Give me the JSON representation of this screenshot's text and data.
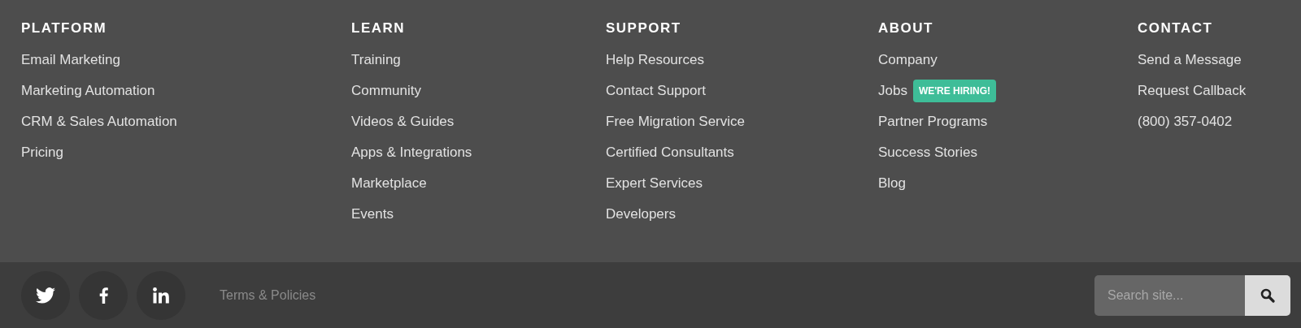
{
  "columns": [
    {
      "heading": "PLATFORM",
      "links": [
        {
          "label": "Email Marketing"
        },
        {
          "label": "Marketing Automation"
        },
        {
          "label": "CRM & Sales Automation"
        },
        {
          "label": "Pricing"
        }
      ]
    },
    {
      "heading": "LEARN",
      "links": [
        {
          "label": "Training"
        },
        {
          "label": "Community"
        },
        {
          "label": "Videos & Guides"
        },
        {
          "label": "Apps & Integrations"
        },
        {
          "label": "Marketplace"
        },
        {
          "label": "Events"
        }
      ]
    },
    {
      "heading": "SUPPORT",
      "links": [
        {
          "label": "Help Resources"
        },
        {
          "label": "Contact Support"
        },
        {
          "label": "Free Migration Service"
        },
        {
          "label": "Certified Consultants"
        },
        {
          "label": "Expert Services"
        },
        {
          "label": "Developers"
        }
      ]
    },
    {
      "heading": "ABOUT",
      "links": [
        {
          "label": "Company"
        },
        {
          "label": "Jobs",
          "badge": "WE'RE HIRING!"
        },
        {
          "label": "Partner Programs"
        },
        {
          "label": "Success Stories"
        },
        {
          "label": "Blog"
        }
      ]
    },
    {
      "heading": "CONTACT",
      "links": [
        {
          "label": "Send a Message"
        },
        {
          "label": "Request Callback"
        },
        {
          "label": "(800) 357-0402"
        }
      ]
    }
  ],
  "bottom_bar": {
    "social": [
      {
        "kind": "twitter"
      },
      {
        "kind": "facebook"
      },
      {
        "kind": "linkedin"
      }
    ],
    "terms_link": "Terms & Policies",
    "search": {
      "placeholder": "Search site..."
    }
  }
}
